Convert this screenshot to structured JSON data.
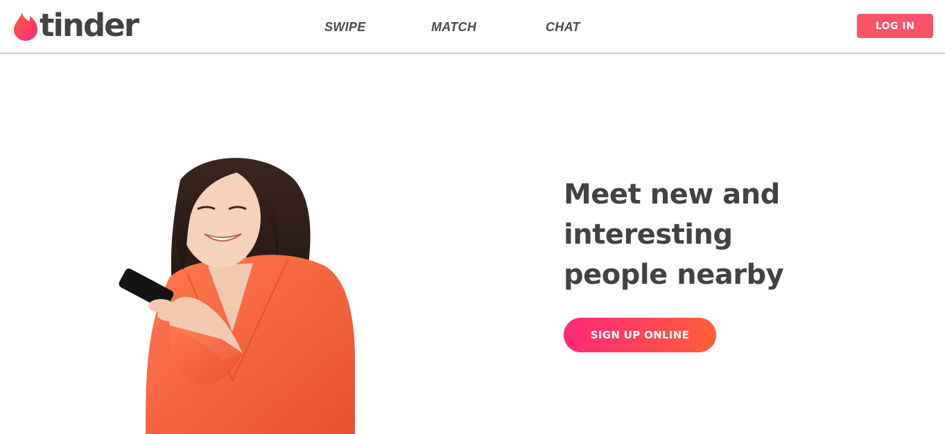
{
  "brand": {
    "name": "tinder",
    "logo_icon": "flame-icon",
    "gradient_start": "#fd267a",
    "gradient_end": "#ff6036",
    "text_color": "#424242"
  },
  "nav": {
    "items": [
      {
        "label": "SWIPE"
      },
      {
        "label": "MATCH"
      },
      {
        "label": "CHAT"
      }
    ],
    "login_label": "LOG IN",
    "login_color": "#fe5268"
  },
  "hero": {
    "headline_lines": [
      "Meet new and",
      "interesting",
      "people nearby"
    ],
    "cta_label": "SIGN UP ONLINE",
    "image": "woman-with-phone-photo"
  }
}
